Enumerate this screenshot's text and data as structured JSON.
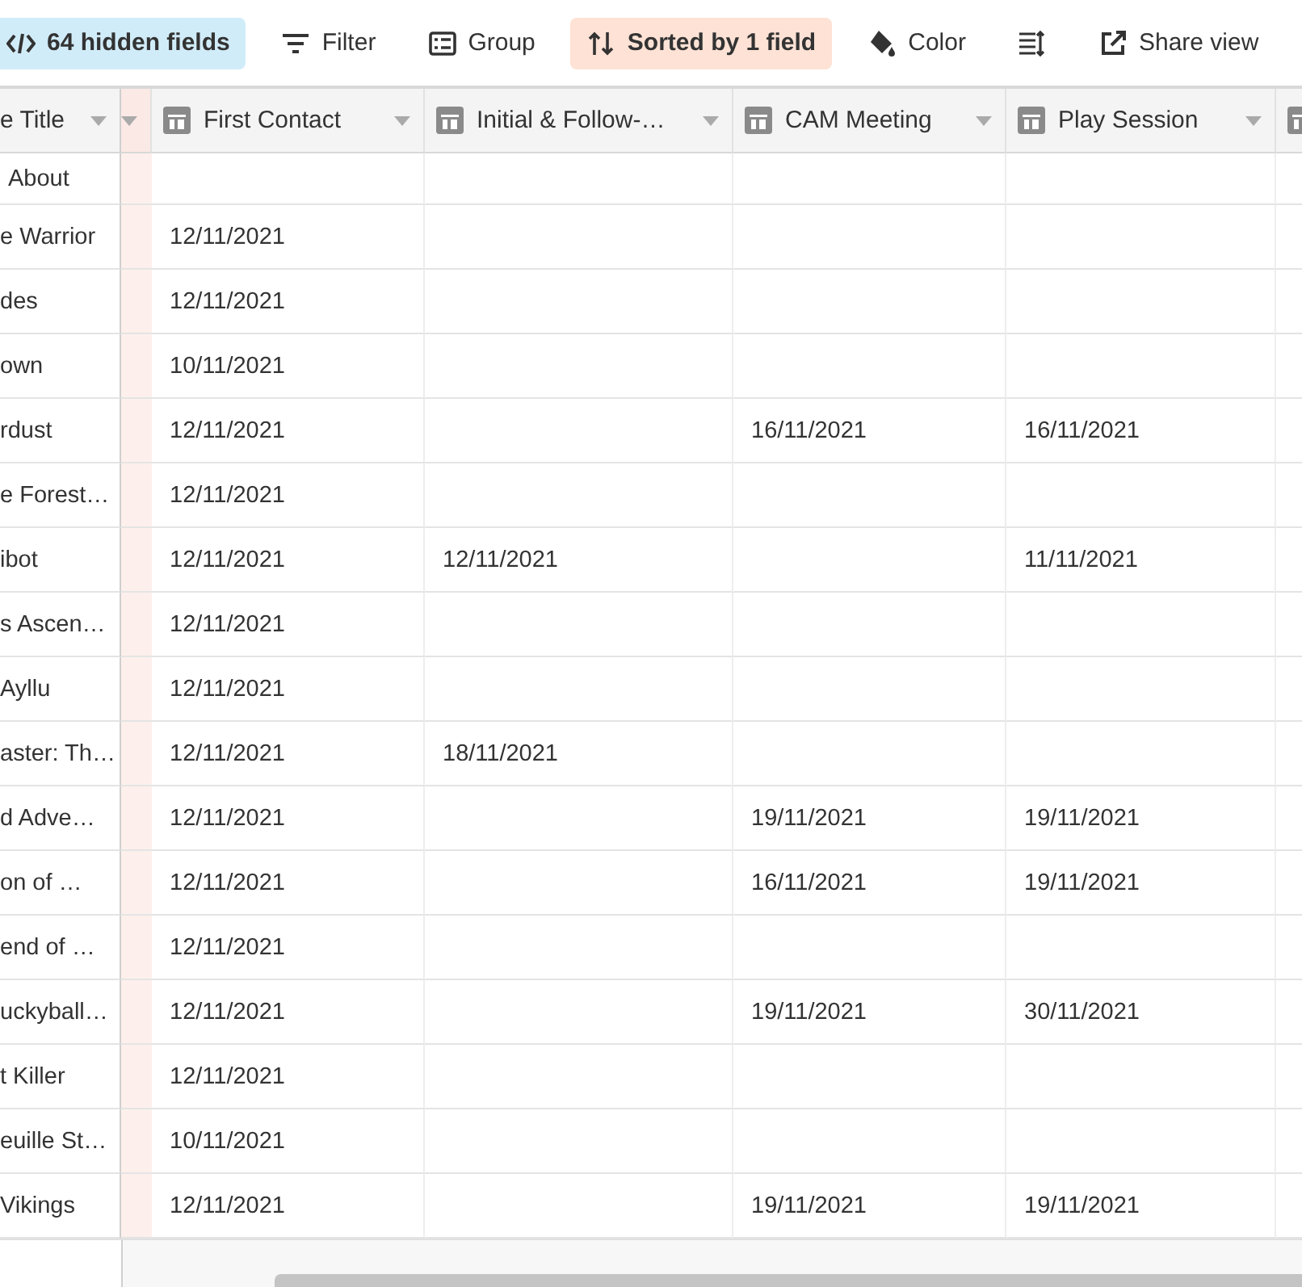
{
  "toolbar": [
    {
      "kind": "hidden",
      "label": "64 hidden fields",
      "active": true
    },
    {
      "kind": "filter",
      "label": "Filter",
      "active": false
    },
    {
      "kind": "group",
      "label": "Group",
      "active": false
    },
    {
      "kind": "sort",
      "label": "Sorted by 1 field",
      "active": true
    },
    {
      "kind": "color",
      "label": "Color",
      "active": false
    },
    {
      "kind": "rowheight",
      "active": false
    },
    {
      "kind": "share",
      "label": "Share view",
      "active": false
    }
  ],
  "table": {
    "columns": [
      {
        "kind": "primary",
        "label": "e Title"
      },
      {
        "kind": "date",
        "label": "First Contact"
      },
      {
        "kind": "date",
        "label": "Initial & Follow-…"
      },
      {
        "kind": "date",
        "label": "CAM Meeting"
      },
      {
        "kind": "date",
        "label": "Play Session"
      },
      {
        "kind": "date"
      }
    ],
    "rows": [
      {
        "cells": [
          "About",
          "",
          "",
          "",
          ""
        ]
      },
      {
        "cells": [
          "e Warrior",
          "12/11/2021",
          "",
          "",
          ""
        ]
      },
      {
        "cells": [
          "des",
          "12/11/2021",
          "",
          "",
          ""
        ]
      },
      {
        "cells": [
          "own",
          "10/11/2021",
          "",
          "",
          ""
        ]
      },
      {
        "cells": [
          "rdust",
          "12/11/2021",
          "",
          "16/11/2021",
          "16/11/2021"
        ]
      },
      {
        "cells": [
          "e Forest…",
          "12/11/2021",
          "",
          "",
          ""
        ]
      },
      {
        "cells": [
          "ibot",
          "12/11/2021",
          "12/11/2021",
          "",
          "11/11/2021"
        ]
      },
      {
        "cells": [
          "s Ascen…",
          "12/11/2021",
          "",
          "",
          ""
        ]
      },
      {
        "cells": [
          "Ayllu",
          "12/11/2021",
          "",
          "",
          ""
        ]
      },
      {
        "cells": [
          "aster: Th…",
          "12/11/2021",
          "18/11/2021",
          "",
          ""
        ]
      },
      {
        "cells": [
          "d Adve…",
          "12/11/2021",
          "",
          "19/11/2021",
          "19/11/2021"
        ]
      },
      {
        "cells": [
          "on of …",
          "12/11/2021",
          "",
          "16/11/2021",
          "19/11/2021"
        ]
      },
      {
        "cells": [
          "end of …",
          "12/11/2021",
          "",
          "",
          ""
        ]
      },
      {
        "cells": [
          "uckyball…",
          "12/11/2021",
          "",
          "19/11/2021",
          "30/11/2021"
        ]
      },
      {
        "cells": [
          "t Killer",
          "12/11/2021",
          "",
          "",
          ""
        ]
      },
      {
        "cells": [
          "euille St…",
          "10/11/2021",
          "",
          "",
          ""
        ]
      },
      {
        "cells": [
          "Vikings",
          "12/11/2021",
          "",
          "19/11/2021",
          "19/11/2021"
        ]
      }
    ]
  }
}
